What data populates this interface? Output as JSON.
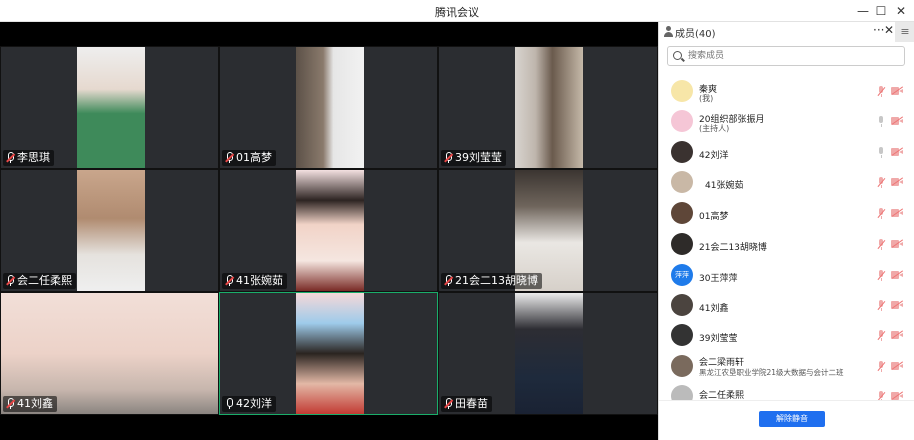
{
  "window": {
    "title": "腾讯会议",
    "minimize": "—",
    "maximize": "☐",
    "close": "✕"
  },
  "video": {
    "tiles": [
      {
        "name": "李思琪",
        "muted": true
      },
      {
        "name": "01高梦",
        "muted": true
      },
      {
        "name": "39刘莹莹",
        "muted": true
      },
      {
        "name": "会二任柔熙",
        "muted": true
      },
      {
        "name": "41张婉茹",
        "muted": true
      },
      {
        "name": "21会二13胡晓博",
        "muted": true
      },
      {
        "name": "41刘鑫",
        "muted": true
      },
      {
        "name": "42刘洋",
        "muted": false,
        "active": true
      },
      {
        "name": "田春苗",
        "muted": true
      }
    ]
  },
  "panel": {
    "title": "成员(40)",
    "more": "···",
    "close": "✕",
    "side_tab": "≡",
    "search_placeholder": "搜索成员",
    "members": [
      {
        "name": "秦爽",
        "sub": "(我)",
        "avatar": "#f7e6a8",
        "mic_on": false
      },
      {
        "name": "20组织部张振月",
        "sub": "(主持人)",
        "avatar": "#f5c6d6",
        "mic_on": true
      },
      {
        "name": "42刘洋",
        "sub": "",
        "avatar": "#3a3230",
        "mic_on": true
      },
      {
        "name": "41张婉茹",
        "sub": "",
        "avatar": "#c9b8a6",
        "mic_on": false
      },
      {
        "name": "01高梦",
        "sub": "",
        "avatar": "#5e4638",
        "mic_on": false
      },
      {
        "name": "21会二13胡晓博",
        "sub": "",
        "avatar": "#2e2b29",
        "mic_on": false
      },
      {
        "name": "30王萍萍",
        "sub": "",
        "avatar": "#1f7bea",
        "avatar_text": "萍萍",
        "mic_on": false
      },
      {
        "name": "41刘鑫",
        "sub": "",
        "avatar": "#4b443f",
        "mic_on": false
      },
      {
        "name": "39刘莹莹",
        "sub": "",
        "avatar": "#333333",
        "mic_on": false
      },
      {
        "name": "会二梁雨轩",
        "sub": "黑龙江农垦职业学院21级大数据与会计二班",
        "avatar": "#7a6a5d",
        "mic_on": false
      },
      {
        "name": "会二任柔熙",
        "sub": "",
        "avatar": "#bbbbbb",
        "mic_on": false
      }
    ],
    "unmute_all": "解除静音"
  },
  "colors": {
    "accent": "#1f6fef",
    "active_tile": "#1aad6a",
    "muted": "#e84646"
  }
}
